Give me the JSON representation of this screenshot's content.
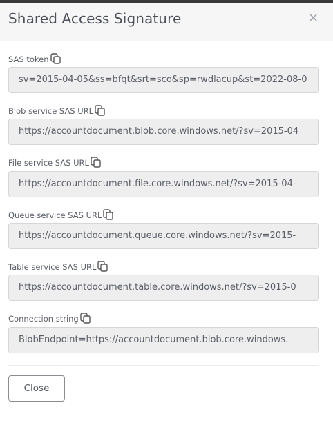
{
  "dialog": {
    "title": "Shared Access Signature",
    "close_icon": "×"
  },
  "fields": [
    {
      "label": "SAS token",
      "value": "sv=2015-04-05&ss=bfqt&srt=sco&sp=rwdlacup&st=2022-08-0",
      "icon": "copy-icon"
    },
    {
      "label": "Blob service SAS URL",
      "value": "https://accountdocument.blob.core.windows.net/?sv=2015-04",
      "icon": "copy-icon"
    },
    {
      "label": "File service SAS URL",
      "value": "https://accountdocument.file.core.windows.net/?sv=2015-04-",
      "icon": "copy-icon"
    },
    {
      "label": "Queue service SAS URL",
      "value": "https://accountdocument.queue.core.windows.net/?sv=2015-",
      "icon": "copy-icon"
    },
    {
      "label": "Table service SAS URL",
      "value": "https://accountdocument.table.core.windows.net/?sv=2015-0",
      "icon": "copy-icon"
    },
    {
      "label": "Connection string",
      "value": "BlobEndpoint=https://accountdocument.blob.core.windows.",
      "icon": "copy-icon"
    }
  ],
  "footer": {
    "close_label": "Close"
  }
}
